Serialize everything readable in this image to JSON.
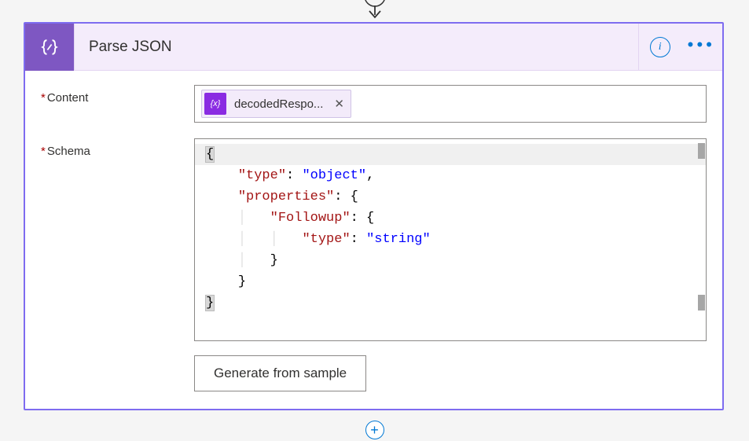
{
  "header": {
    "title": "Parse JSON"
  },
  "fields": {
    "content": {
      "label": "Content",
      "token_label": "decodedRespo...",
      "token_icon_text": "{x}"
    },
    "schema": {
      "label": "Schema",
      "tokens": {
        "l1_open": "{",
        "l2_key": "\"type\"",
        "l2_colon": ": ",
        "l2_val": "\"object\"",
        "l2_comma": ",",
        "l3_key": "\"properties\"",
        "l3_colon": ": {",
        "l4_key": "\"Followup\"",
        "l4_colon": ": {",
        "l5_key": "\"type\"",
        "l5_colon": ": ",
        "l5_val": "\"string\"",
        "l6_close": "}",
        "l7_close": "}",
        "l8_close": "}"
      }
    }
  },
  "buttons": {
    "generate": "Generate from sample"
  },
  "info_label": "i",
  "ellipsis": "• • •",
  "add": "+"
}
